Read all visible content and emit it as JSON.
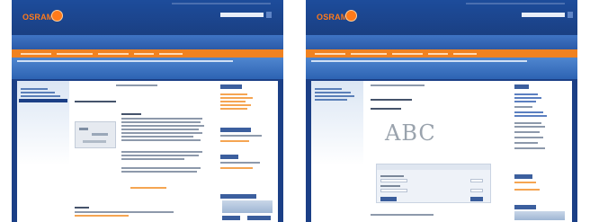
{
  "screenshots": [
    {
      "id": "left",
      "logo": "OSRAM",
      "layout": "article-page"
    },
    {
      "id": "right",
      "logo": "OSRAM",
      "layout": "captcha-form-page",
      "captcha_text": "ABC"
    }
  ],
  "colors": {
    "header_blue": "#1b3f86",
    "nav_orange": "#f08220",
    "wave_blue": "#3f74c4"
  }
}
